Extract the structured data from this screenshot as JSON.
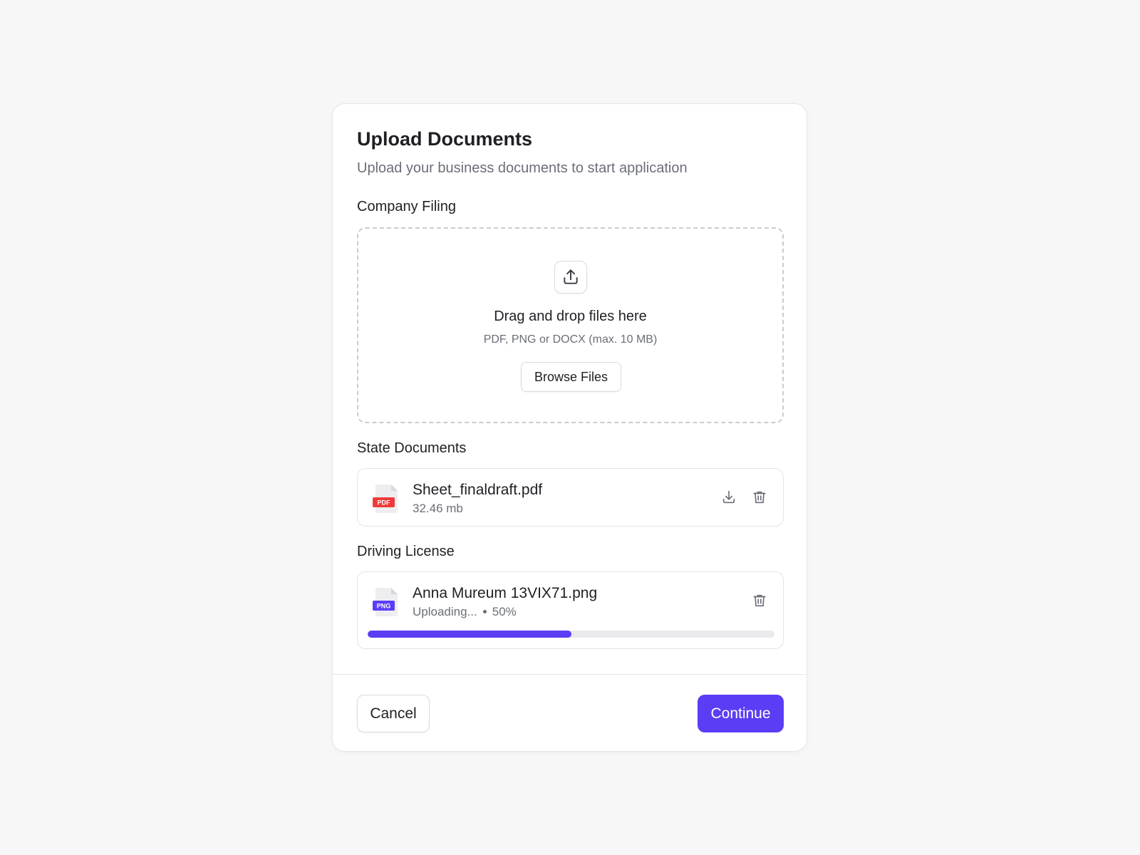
{
  "modal": {
    "title": "Upload Documents",
    "subtitle": "Upload your business documents to start application"
  },
  "company_filing": {
    "label": "Company Filing",
    "dropzone": {
      "title": "Drag and drop files here",
      "hint": "PDF, PNG or DOCX (max. 10 MB)",
      "browse_label": "Browse Files",
      "icon": "upload-icon"
    }
  },
  "state_documents": {
    "label": "State Documents",
    "file": {
      "name": "Sheet_finaldraft.pdf",
      "size": "32.46 mb",
      "badge": "PDF",
      "badge_color": "#ef3a3a",
      "actions": [
        "download-icon",
        "trash-icon"
      ]
    }
  },
  "driving_license": {
    "label": "Driving License",
    "file": {
      "name": "Anna Mureum 13VIX71.png",
      "status": "Uploading...",
      "percent_label": "50%",
      "progress": 0.5,
      "badge": "PNG",
      "badge_color": "#5b3df5",
      "actions": [
        "trash-icon"
      ]
    }
  },
  "footer": {
    "cancel_label": "Cancel",
    "continue_label": "Continue"
  },
  "colors": {
    "accent": "#5b3df5",
    "background": "#f7f7f8",
    "text_primary": "#1f2024",
    "text_secondary": "#6b6e78"
  }
}
